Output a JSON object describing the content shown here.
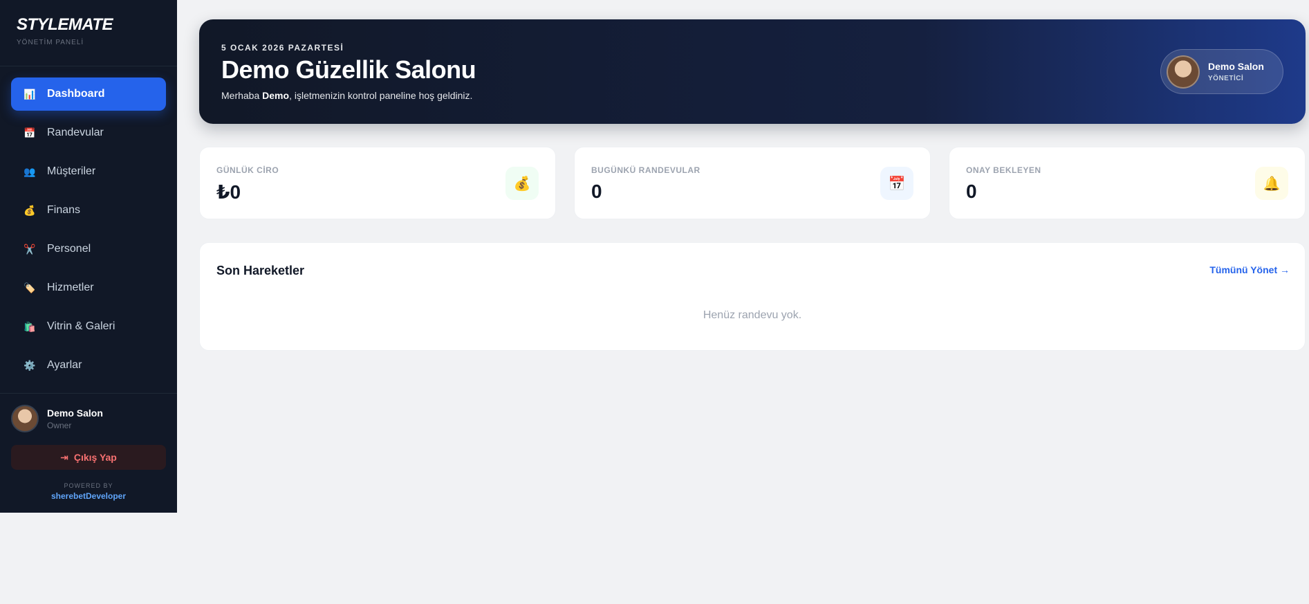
{
  "brand": {
    "title": "STYLEMATE",
    "subtitle": "YÖNETİM PANELİ"
  },
  "nav": [
    {
      "label": "Dashboard",
      "icon": "📊",
      "active": true
    },
    {
      "label": "Randevular",
      "icon": "📅"
    },
    {
      "label": "Müşteriler",
      "icon": "👥"
    },
    {
      "label": "Finans",
      "icon": "💰"
    },
    {
      "label": "Personel",
      "icon": "✂️"
    },
    {
      "label": "Hizmetler",
      "icon": "🏷️"
    },
    {
      "label": "Vitrin & Galeri",
      "icon": "🛍️"
    },
    {
      "label": "Ayarlar",
      "icon": "⚙️"
    }
  ],
  "sidebar_user": {
    "name": "Demo Salon",
    "role": "Owner"
  },
  "logout": {
    "label": "Çıkış Yap",
    "icon": "⇥"
  },
  "powered": {
    "label": "POWERED BY",
    "brand": "sherebetDeveloper"
  },
  "hero": {
    "date": "5 OCAK 2026 PAZARTESİ",
    "title": "Demo Güzellik Salonu",
    "welcome_prefix": "Merhaba ",
    "welcome_name": "Demo",
    "welcome_suffix": ", işletmenizin kontrol paneline hoş geldiniz.",
    "user_name": "Demo Salon",
    "user_role": "YÖNETİCİ"
  },
  "stats": [
    {
      "label": "GÜNLÜK CİRO",
      "value": "₺0",
      "icon": "💰",
      "icon_bg": "#f0fdf4"
    },
    {
      "label": "BUGÜNKÜ RANDEVULAR",
      "value": "0",
      "icon": "📅",
      "icon_bg": "#eff6ff"
    },
    {
      "label": "ONAY BEKLEYEN",
      "value": "0",
      "icon": "🔔",
      "icon_bg": "#fefce8"
    }
  ],
  "activity": {
    "title": "Son Hareketler",
    "link": "Tümünü Yönet →",
    "empty": "Henüz randevu yok."
  },
  "colors": {
    "sidebar_bg": "#111827",
    "accent": "#2563eb",
    "danger": "#f87171"
  }
}
